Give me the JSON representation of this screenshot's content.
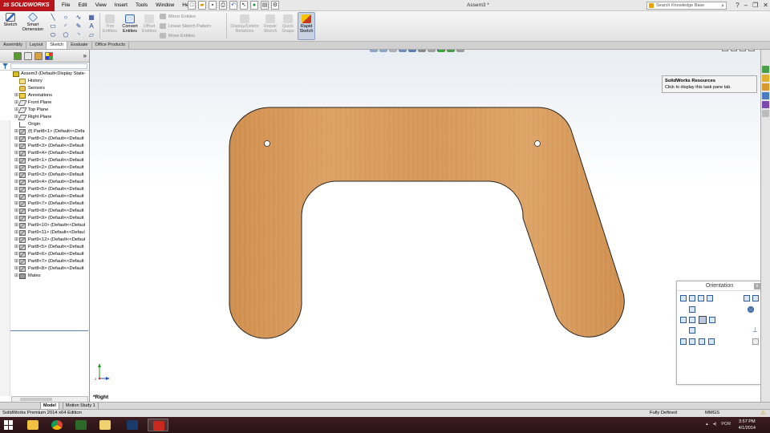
{
  "app": {
    "logo_brand": "SOLIDWORKS",
    "logo_mark": "3S",
    "window_title": "Assem3 *"
  },
  "menu": [
    "File",
    "Edit",
    "View",
    "Insert",
    "Tools",
    "Window",
    "Help"
  ],
  "search": {
    "placeholder": "Search Knowledge Base"
  },
  "ribbon": {
    "sketch": "Sketch",
    "smart_dimension": [
      "Smart",
      "Dimension"
    ],
    "trim_entities": [
      "Trim",
      "Entities"
    ],
    "convert_entities": [
      "Convert",
      "Entities"
    ],
    "offset_entities": [
      "Offset",
      "Entities"
    ],
    "mirror_entities": "Mirror Entities",
    "linear_sketch_pattern": "Linear Sketch Pattern",
    "move_entities": "Move Entities",
    "display_delete_relations": [
      "Display/Delete",
      "Relations"
    ],
    "repair_sketch": [
      "Repair",
      "Sketch"
    ],
    "quick_snaps": [
      "Quick",
      "Snaps"
    ],
    "rapid_sketch": [
      "Rapid",
      "Sketch"
    ]
  },
  "tabs": [
    "Assembly",
    "Layout",
    "Sketch",
    "Evaluate",
    "Office Products"
  ],
  "active_tab": "Sketch",
  "tree": {
    "root": "Assem3 (Default<Display State-",
    "items": [
      "History",
      "Sensors",
      "Annotations",
      "Front Plane",
      "Top Plane",
      "Right Plane",
      "Origin",
      "(f) Part8<1> (Default<<Defa",
      "Part8<2> (Default<<Default",
      "Part8<3> (Default<<Default",
      "Part8<4> (Default<<Default",
      "Part9<1> (Default<<Default",
      "Part9<2> (Default<<Default",
      "Part9<3> (Default<<Default",
      "Part9<4> (Default<<Default",
      "Part9<5> (Default<<Default",
      "Part9<6> (Default<<Default",
      "Part9<7> (Default<<Default",
      "Part9<8> (Default<<Default",
      "Part9<9> (Default<<Default",
      "Part9<10> (Default<<Defaul",
      "Part9<11> (Default<<Defaul",
      "Part9<12> (Default<<Defaul",
      "Part8<5> (Default<<Default",
      "Part8<6> (Default<<Default",
      "Part8<7> (Default<<Default",
      "Part8<8> (Default<<Default",
      "Mates"
    ]
  },
  "resources_tip": {
    "title": "SolidWorks Resources",
    "text": "Click to display this task pane tab."
  },
  "view_label": "*Right",
  "orientation": {
    "title": "Orientation",
    "close": "x"
  },
  "bottom_tabs": [
    "Model",
    "Motion Study 1"
  ],
  "status": {
    "edition": "SolidWorks Premium 2014 x64 Edition",
    "defined": "Fully Defined",
    "units": "MMGS"
  },
  "taskbar": {
    "lang": "POR",
    "time": "3:57 PM",
    "date": "4/1/2014"
  },
  "colors": {
    "wood": "#d79a5a",
    "brand_red": "#b8141b",
    "taskbar": "#341a1d"
  }
}
